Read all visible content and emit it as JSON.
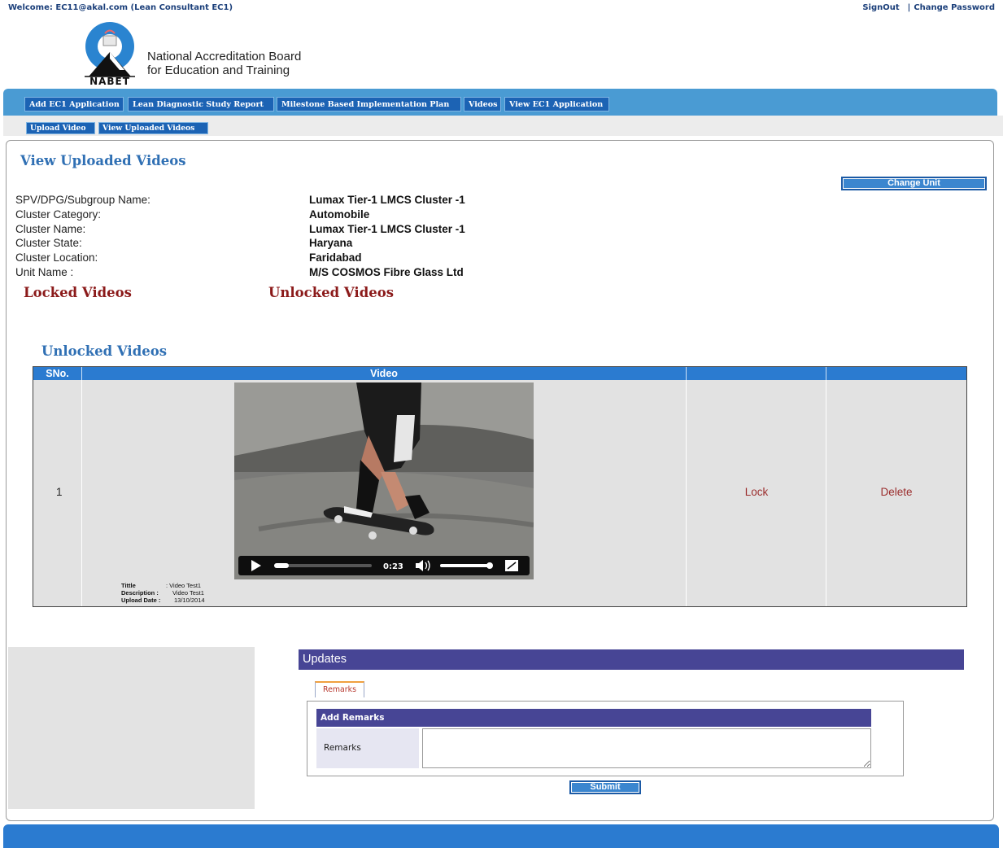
{
  "header": {
    "welcome": "Welcome: EC11@akal.com (Lean Consultant EC1)",
    "signout": "SignOut",
    "separator": "|",
    "change_password": "Change Password"
  },
  "logo": {
    "wordmark": "NABET",
    "line1": "National Accreditation Board",
    "line2": "for Education and Training"
  },
  "main_nav": {
    "items": [
      {
        "label": "Add EC1 Application"
      },
      {
        "label": "Lean Diagnostic Study Report"
      },
      {
        "label": "Milestone Based Implementation Plan"
      },
      {
        "label": "Videos"
      },
      {
        "label": "View EC1 Application"
      }
    ]
  },
  "sub_nav": {
    "items": [
      {
        "label": "Upload Video"
      },
      {
        "label": "View Uploaded Videos"
      }
    ]
  },
  "page": {
    "title": "View Uploaded Videos",
    "change_unit": "Change Unit",
    "info": [
      {
        "label": "SPV/DPG/Subgroup Name:",
        "value": "Lumax Tier-1 LMCS Cluster -1"
      },
      {
        "label": "Cluster Category:",
        "value": "Automobile"
      },
      {
        "label": "Cluster Name:",
        "value": "Lumax Tier-1 LMCS Cluster -1"
      },
      {
        "label": "Cluster State:",
        "value": "Haryana"
      },
      {
        "label": "Cluster Location:",
        "value": "Faridabad"
      },
      {
        "label": "Unit Name :",
        "value": "M/S COSMOS Fibre Glass Ltd"
      }
    ],
    "locked_link": "Locked Videos",
    "unlocked_link": "Unlocked Videos",
    "section_title": "Unlocked Videos"
  },
  "table": {
    "headers": [
      "SNo.",
      "Video",
      "",
      ""
    ],
    "rows": [
      {
        "sno": "1",
        "video_time": "0:23",
        "meta_title_label": "Tittle",
        "meta_title_value": ":   Video Test1",
        "meta_desc_label": "Description :",
        "meta_desc_value": "Video Test1",
        "meta_date_label": "Upload Date :",
        "meta_date_value": "13/10/2014",
        "lock": "Lock",
        "delete": "Delete"
      }
    ]
  },
  "updates": {
    "title": "Updates",
    "tab": "Remarks",
    "form_title": "Add Remarks",
    "remarks_label": "Remarks",
    "remarks_value": "",
    "submit": "Submit"
  },
  "colors": {
    "nav_blue": "#4a9bd3",
    "button_blue": "#1c63b4",
    "header_blue": "#2b7bd0",
    "title_blue": "#3070b4",
    "dark_red": "#8b1a1a",
    "updates_purple": "#474595"
  }
}
